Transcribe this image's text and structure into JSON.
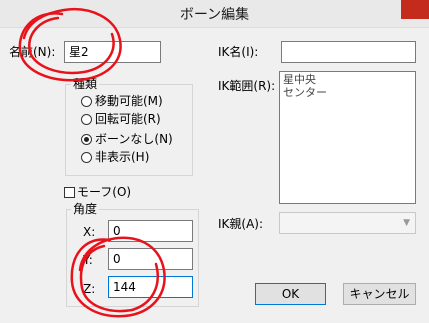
{
  "titlebar": {
    "title": "ボーン編集",
    "close_icon": "close-icon",
    "close_color": "#c42b1c"
  },
  "name": {
    "label": "名前(N):",
    "value": "星2"
  },
  "ik_name": {
    "label": "IK名(I):",
    "value": ""
  },
  "kind": {
    "title": "種類",
    "options": [
      {
        "label": "移動可能(M)",
        "checked": false
      },
      {
        "label": "回転可能(R)",
        "checked": false
      },
      {
        "label": "ボーンなし(N)",
        "checked": true
      },
      {
        "label": "非表示(H)",
        "checked": false
      }
    ]
  },
  "ik_range": {
    "label": "IK範囲(R):",
    "items": [
      "星中央",
      "センター"
    ]
  },
  "morph": {
    "label": "モーフ(O)",
    "checked": false
  },
  "angle": {
    "title": "角度",
    "x_label": "X:",
    "x_value": "0",
    "y_label": "Y:",
    "y_value": "0",
    "z_label": "Z:",
    "z_value": "144"
  },
  "ik_parent": {
    "label": "IK親(A):",
    "value": ""
  },
  "buttons": {
    "ok": "OK",
    "cancel": "キャンセル"
  },
  "annotation": {
    "color": "#e8121b"
  }
}
